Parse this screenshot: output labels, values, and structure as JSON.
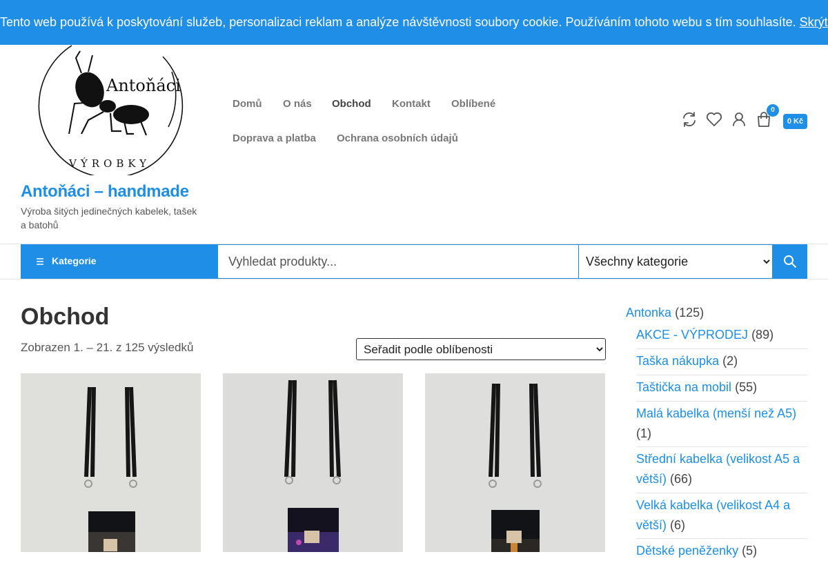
{
  "cookie": {
    "message": "Tento web používá k poskytování služeb, personalizaci reklam a analýze návštěvnosti soubory cookie. Používáním tohoto webu s tím souhlasíte.",
    "hide_label": "Skrýt"
  },
  "site": {
    "logo_text_top": "Antoňáci",
    "logo_text_bottom": "VÝROBKY",
    "title": "Antoňáci – handmade",
    "description": "Výroba šitých jedinečných kabelek, tašek a batohů"
  },
  "nav": {
    "home": "Domů",
    "about": "O nás",
    "shop": "Obchod",
    "contact": "Kontakt",
    "favorites": "Oblíbené",
    "shipping": "Doprava a platba",
    "privacy": "Ochrana osobních údajů"
  },
  "header_icons": [
    "compare-icon",
    "heart-icon",
    "user-icon",
    "cart-icon"
  ],
  "cart": {
    "count": "0",
    "total": "0 Kč"
  },
  "search": {
    "categories_label": "Kategorie",
    "placeholder": "Vyhledat produkty...",
    "category_selected": "Všechny kategorie"
  },
  "shop": {
    "title": "Obchod",
    "result_count": "Zobrazen 1. – 21. z 125 výsledků",
    "sort_selected": "Seřadit podle oblíbenosti"
  },
  "sidebar": {
    "parent": {
      "label": "Antonka",
      "count": "(125)"
    },
    "items": [
      {
        "label": "AKCE - VÝPRODEJ",
        "count": "(89)"
      },
      {
        "label": "Taška nákupka",
        "count": "(2)"
      },
      {
        "label": "Taštička na mobil",
        "count": "(55)"
      },
      {
        "label": "Malá kabelka (menší než A5)",
        "count": "(1)"
      },
      {
        "label": "Střední kabelka (velikost A5 a větší)",
        "count": "(66)"
      },
      {
        "label": "Velká kabelka (velikost A4 a větší)",
        "count": "(6)"
      },
      {
        "label": "Dětské peněženky",
        "count": "(5)"
      }
    ]
  },
  "colors": {
    "accent": "#1e8ee6",
    "text": "#333333",
    "product_background": "#dfe0dc"
  }
}
